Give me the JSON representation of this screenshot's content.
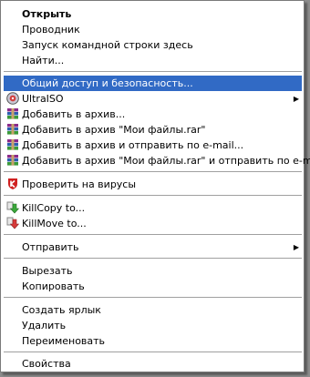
{
  "menu": {
    "open": "Открыть",
    "explorer": "Проводник",
    "cmd": "Запуск командной строки здесь",
    "find": "Найти...",
    "sharing": "Общий доступ и безопасность...",
    "ultraiso": "UltraISO",
    "add_archive": "Добавить в архив...",
    "add_rar": "Добавить в архив \"Мои файлы.rar\"",
    "add_email": "Добавить в архив и отправить по e-mail...",
    "add_rar_email": "Добавить в архив \"Мои файлы.rar\" и отправить по e-mail",
    "virus": "Проверить на вирусы",
    "killcopy": "KillCopy to...",
    "killmove": "KillMove to...",
    "send": "Отправить",
    "cut": "Вырезать",
    "copy": "Копировать",
    "shortcut": "Создать ярлык",
    "delete": "Удалить",
    "rename": "Переименовать",
    "properties": "Свойства",
    "submenu_arrow": "▶"
  },
  "colors": {
    "highlight": "#316ac5",
    "menu_bg": "#ffffff"
  }
}
